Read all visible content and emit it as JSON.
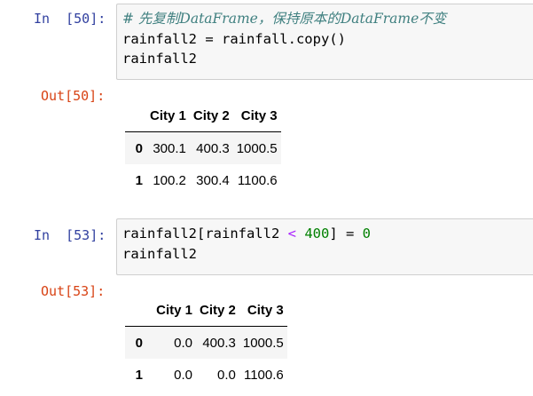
{
  "cells": [
    {
      "in_prompt": "In  [50]:",
      "code_lines": {
        "line1": "# 先复制DataFrame，保持原本的DataFrame不变",
        "line2": "rainfall2 = rainfall.copy()",
        "line3": "rainfall2"
      },
      "out_prompt": "Out[50]:",
      "table": {
        "columns": [
          "City 1",
          "City 2",
          "City 3"
        ],
        "rows": [
          {
            "index": "0",
            "values": [
              "300.1",
              "400.3",
              "1000.5"
            ]
          },
          {
            "index": "1",
            "values": [
              "100.2",
              "300.4",
              "1100.6"
            ]
          }
        ]
      }
    },
    {
      "in_prompt": "In  [53]:",
      "code_lines": {
        "line1_a": "rainfall2[rainfall2 ",
        "line1_op": "<",
        "line1_b": " ",
        "line1_num": "400",
        "line1_c": "] = ",
        "line1_num2": "0",
        "line2": "rainfall2"
      },
      "out_prompt": "Out[53]:",
      "table": {
        "columns": [
          "City 1",
          "City 2",
          "City 3"
        ],
        "rows": [
          {
            "index": "0",
            "values": [
              "0.0",
              "400.3",
              "1000.5"
            ]
          },
          {
            "index": "1",
            "values": [
              "0.0",
              "0.0",
              "1100.6"
            ]
          }
        ]
      }
    }
  ],
  "colors": {
    "in_prompt": "#303f9f",
    "out_prompt": "#d84315",
    "comment": "#408080",
    "operator": "#aa22ff",
    "number": "#008000",
    "input_bg": "#f7f7f7",
    "row_stripe": "#f5f5f5"
  }
}
